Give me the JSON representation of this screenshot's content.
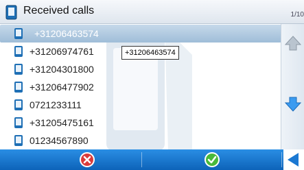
{
  "title": "Received calls",
  "page_indicator": "1/10",
  "tooltip": "+31206463574",
  "calls": [
    {
      "number": "+31206463574",
      "selected": true
    },
    {
      "number": "+31206974761",
      "selected": false
    },
    {
      "number": "+31204301800",
      "selected": false
    },
    {
      "number": "+31206477902",
      "selected": false
    },
    {
      "number": "0721233111",
      "selected": false
    },
    {
      "number": "+31205475161",
      "selected": false
    },
    {
      "number": "01234567890",
      "selected": false
    }
  ],
  "icons": {
    "title": "phone-icon",
    "row": "phone-icon",
    "scroll_up": "arrow-up-icon",
    "scroll_down": "arrow-down-icon",
    "cancel": "cancel-icon",
    "ok": "check-icon",
    "back": "back-arrow-icon"
  },
  "colors": {
    "accent": "#1b78d2",
    "selection": "#a9c4dc",
    "cancel": "#d83a3a",
    "ok": "#49b93b"
  }
}
